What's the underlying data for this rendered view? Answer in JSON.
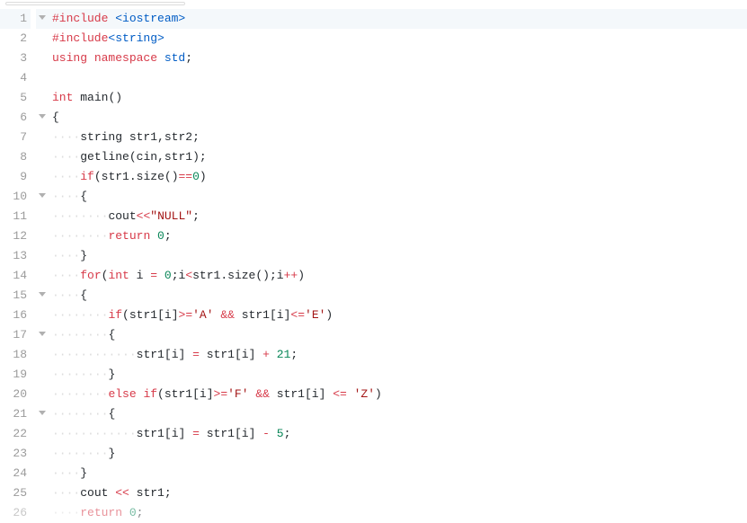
{
  "editor": {
    "active_line": 1,
    "lines": [
      {
        "num": 1,
        "fold": true,
        "indent": 0,
        "tokens": [
          {
            "t": "#include ",
            "c": "k-red"
          },
          {
            "t": "<iostream>",
            "c": "k-teal"
          }
        ]
      },
      {
        "num": 2,
        "fold": false,
        "indent": 0,
        "tokens": [
          {
            "t": "#include",
            "c": "k-red"
          },
          {
            "t": "<string>",
            "c": "k-teal"
          }
        ]
      },
      {
        "num": 3,
        "fold": false,
        "indent": 0,
        "tokens": [
          {
            "t": "using ",
            "c": "k-red"
          },
          {
            "t": "namespace ",
            "c": "k-red"
          },
          {
            "t": "std",
            "c": "k-teal"
          },
          {
            "t": ";",
            "c": "k-black"
          }
        ]
      },
      {
        "num": 4,
        "fold": false,
        "indent": 0,
        "tokens": []
      },
      {
        "num": 5,
        "fold": false,
        "indent": 0,
        "tokens": [
          {
            "t": "int ",
            "c": "k-red"
          },
          {
            "t": "main",
            "c": "k-black"
          },
          {
            "t": "()",
            "c": "k-black"
          }
        ]
      },
      {
        "num": 6,
        "fold": true,
        "indent": 0,
        "tokens": [
          {
            "t": "{",
            "c": "k-black"
          }
        ]
      },
      {
        "num": 7,
        "fold": false,
        "indent": 1,
        "tokens": [
          {
            "t": "string ",
            "c": "k-black"
          },
          {
            "t": "str1",
            "c": "k-black"
          },
          {
            "t": ",",
            "c": "k-black"
          },
          {
            "t": "str2",
            "c": "k-black"
          },
          {
            "t": ";",
            "c": "k-black"
          }
        ]
      },
      {
        "num": 8,
        "fold": false,
        "indent": 1,
        "tokens": [
          {
            "t": "getline",
            "c": "k-black"
          },
          {
            "t": "(",
            "c": "k-black"
          },
          {
            "t": "cin",
            "c": "k-black"
          },
          {
            "t": ",",
            "c": "k-black"
          },
          {
            "t": "str1",
            "c": "k-black"
          },
          {
            "t": ");",
            "c": "k-black"
          }
        ]
      },
      {
        "num": 9,
        "fold": false,
        "indent": 1,
        "tokens": [
          {
            "t": "if",
            "c": "k-red"
          },
          {
            "t": "(",
            "c": "k-black"
          },
          {
            "t": "str1",
            "c": "k-black"
          },
          {
            "t": ".",
            "c": "k-black"
          },
          {
            "t": "size",
            "c": "k-black"
          },
          {
            "t": "()",
            "c": "k-black"
          },
          {
            "t": "==",
            "c": "k-red"
          },
          {
            "t": "0",
            "c": "k-green"
          },
          {
            "t": ")",
            "c": "k-black"
          }
        ]
      },
      {
        "num": 10,
        "fold": true,
        "indent": 1,
        "tokens": [
          {
            "t": "{",
            "c": "k-black"
          }
        ]
      },
      {
        "num": 11,
        "fold": false,
        "indent": 2,
        "tokens": [
          {
            "t": "cout",
            "c": "k-black"
          },
          {
            "t": "<<",
            "c": "k-red"
          },
          {
            "t": "\"NULL\"",
            "c": "k-darkred"
          },
          {
            "t": ";",
            "c": "k-black"
          }
        ]
      },
      {
        "num": 12,
        "fold": false,
        "indent": 2,
        "tokens": [
          {
            "t": "return ",
            "c": "k-red"
          },
          {
            "t": "0",
            "c": "k-green"
          },
          {
            "t": ";",
            "c": "k-black"
          }
        ]
      },
      {
        "num": 13,
        "fold": false,
        "indent": 1,
        "tokens": [
          {
            "t": "}",
            "c": "k-black"
          }
        ]
      },
      {
        "num": 14,
        "fold": false,
        "indent": 1,
        "tokens": [
          {
            "t": "for",
            "c": "k-red"
          },
          {
            "t": "(",
            "c": "k-black"
          },
          {
            "t": "int ",
            "c": "k-red"
          },
          {
            "t": "i ",
            "c": "k-black"
          },
          {
            "t": "= ",
            "c": "k-red"
          },
          {
            "t": "0",
            "c": "k-green"
          },
          {
            "t": ";",
            "c": "k-black"
          },
          {
            "t": "i",
            "c": "k-black"
          },
          {
            "t": "<",
            "c": "k-red"
          },
          {
            "t": "str1",
            "c": "k-black"
          },
          {
            "t": ".",
            "c": "k-black"
          },
          {
            "t": "size",
            "c": "k-black"
          },
          {
            "t": "();",
            "c": "k-black"
          },
          {
            "t": "i",
            "c": "k-black"
          },
          {
            "t": "++",
            "c": "k-red"
          },
          {
            "t": ")",
            "c": "k-black"
          }
        ]
      },
      {
        "num": 15,
        "fold": true,
        "indent": 1,
        "tokens": [
          {
            "t": "{",
            "c": "k-black"
          }
        ]
      },
      {
        "num": 16,
        "fold": false,
        "indent": 2,
        "tokens": [
          {
            "t": "if",
            "c": "k-red"
          },
          {
            "t": "(",
            "c": "k-black"
          },
          {
            "t": "str1",
            "c": "k-black"
          },
          {
            "t": "[",
            "c": "k-black"
          },
          {
            "t": "i",
            "c": "k-black"
          },
          {
            "t": "]",
            "c": "k-black"
          },
          {
            "t": ">=",
            "c": "k-red"
          },
          {
            "t": "'A'",
            "c": "k-darkred"
          },
          {
            "t": " && ",
            "c": "k-red"
          },
          {
            "t": "str1",
            "c": "k-black"
          },
          {
            "t": "[",
            "c": "k-black"
          },
          {
            "t": "i",
            "c": "k-black"
          },
          {
            "t": "]",
            "c": "k-black"
          },
          {
            "t": "<=",
            "c": "k-red"
          },
          {
            "t": "'E'",
            "c": "k-darkred"
          },
          {
            "t": ")",
            "c": "k-black"
          }
        ]
      },
      {
        "num": 17,
        "fold": true,
        "indent": 2,
        "tokens": [
          {
            "t": "{",
            "c": "k-black"
          }
        ]
      },
      {
        "num": 18,
        "fold": false,
        "indent": 3,
        "tokens": [
          {
            "t": "str1",
            "c": "k-black"
          },
          {
            "t": "[",
            "c": "k-black"
          },
          {
            "t": "i",
            "c": "k-black"
          },
          {
            "t": "] ",
            "c": "k-black"
          },
          {
            "t": "= ",
            "c": "k-red"
          },
          {
            "t": "str1",
            "c": "k-black"
          },
          {
            "t": "[",
            "c": "k-black"
          },
          {
            "t": "i",
            "c": "k-black"
          },
          {
            "t": "] ",
            "c": "k-black"
          },
          {
            "t": "+ ",
            "c": "k-red"
          },
          {
            "t": "21",
            "c": "k-green"
          },
          {
            "t": ";",
            "c": "k-black"
          }
        ]
      },
      {
        "num": 19,
        "fold": false,
        "indent": 2,
        "tokens": [
          {
            "t": "}",
            "c": "k-black"
          }
        ]
      },
      {
        "num": 20,
        "fold": false,
        "indent": 2,
        "tokens": [
          {
            "t": "else if",
            "c": "k-red"
          },
          {
            "t": "(",
            "c": "k-black"
          },
          {
            "t": "str1",
            "c": "k-black"
          },
          {
            "t": "[",
            "c": "k-black"
          },
          {
            "t": "i",
            "c": "k-black"
          },
          {
            "t": "]",
            "c": "k-black"
          },
          {
            "t": ">=",
            "c": "k-red"
          },
          {
            "t": "'F'",
            "c": "k-darkred"
          },
          {
            "t": " && ",
            "c": "k-red"
          },
          {
            "t": "str1",
            "c": "k-black"
          },
          {
            "t": "[",
            "c": "k-black"
          },
          {
            "t": "i",
            "c": "k-black"
          },
          {
            "t": "] ",
            "c": "k-black"
          },
          {
            "t": "<= ",
            "c": "k-red"
          },
          {
            "t": "'Z'",
            "c": "k-darkred"
          },
          {
            "t": ")",
            "c": "k-black"
          }
        ]
      },
      {
        "num": 21,
        "fold": true,
        "indent": 2,
        "tokens": [
          {
            "t": "{",
            "c": "k-black"
          }
        ]
      },
      {
        "num": 22,
        "fold": false,
        "indent": 3,
        "tokens": [
          {
            "t": "str1",
            "c": "k-black"
          },
          {
            "t": "[",
            "c": "k-black"
          },
          {
            "t": "i",
            "c": "k-black"
          },
          {
            "t": "] ",
            "c": "k-black"
          },
          {
            "t": "= ",
            "c": "k-red"
          },
          {
            "t": "str1",
            "c": "k-black"
          },
          {
            "t": "[",
            "c": "k-black"
          },
          {
            "t": "i",
            "c": "k-black"
          },
          {
            "t": "] ",
            "c": "k-black"
          },
          {
            "t": "- ",
            "c": "k-red"
          },
          {
            "t": "5",
            "c": "k-green"
          },
          {
            "t": ";",
            "c": "k-black"
          }
        ]
      },
      {
        "num": 23,
        "fold": false,
        "indent": 2,
        "tokens": [
          {
            "t": "}",
            "c": "k-black"
          }
        ]
      },
      {
        "num": 24,
        "fold": false,
        "indent": 1,
        "tokens": [
          {
            "t": "}",
            "c": "k-black"
          }
        ]
      },
      {
        "num": 25,
        "fold": false,
        "indent": 1,
        "tokens": [
          {
            "t": "cout ",
            "c": "k-black"
          },
          {
            "t": "<< ",
            "c": "k-red"
          },
          {
            "t": "str1",
            "c": "k-black"
          },
          {
            "t": ";",
            "c": "k-black"
          }
        ]
      },
      {
        "num": 26,
        "fold": false,
        "indent": 1,
        "faded": true,
        "tokens": [
          {
            "t": "return ",
            "c": "k-red"
          },
          {
            "t": "0",
            "c": "k-green"
          },
          {
            "t": ";",
            "c": "k-black"
          }
        ]
      }
    ]
  }
}
